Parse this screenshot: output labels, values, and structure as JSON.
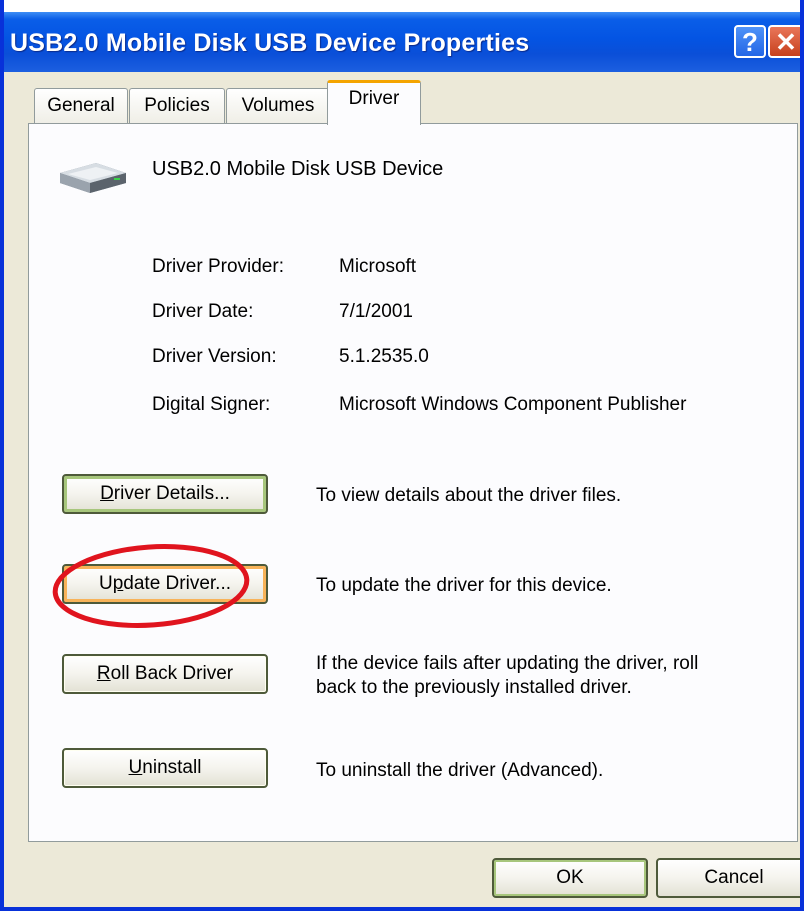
{
  "window": {
    "title": "USB2.0 Mobile Disk USB Device Properties",
    "help_label": "?",
    "close_label": "✕"
  },
  "tabs": [
    {
      "label": "General"
    },
    {
      "label": "Policies"
    },
    {
      "label": "Volumes"
    },
    {
      "label": "Driver",
      "active": true
    }
  ],
  "device": {
    "icon": "disk-drive-icon",
    "name": "USB2.0 Mobile Disk USB Device"
  },
  "driver_info": [
    {
      "label": "Driver Provider:",
      "value": "Microsoft"
    },
    {
      "label": "Driver Date:",
      "value": "7/1/2001"
    },
    {
      "label": "Driver Version:",
      "value": "5.1.2535.0"
    },
    {
      "label": "Digital Signer:",
      "value": "Microsoft Windows Component Publisher"
    }
  ],
  "actions": {
    "details": {
      "label_pre": "",
      "label_key": "D",
      "label_post": "river Details...",
      "desc": "To view details about the driver files."
    },
    "update": {
      "label_pre": "U",
      "label_key": "p",
      "label_post": "date Driver...",
      "desc": "To update the driver for this device."
    },
    "rollback": {
      "label_pre": "",
      "label_key": "R",
      "label_post": "oll Back Driver",
      "desc_line1": "If the device fails after updating the driver, roll",
      "desc_line2": "back to the previously installed driver."
    },
    "uninstall": {
      "label_pre": "",
      "label_key": "U",
      "label_post": "ninstall",
      "desc": "To uninstall the driver (Advanced)."
    }
  },
  "footer": {
    "ok_label": "OK",
    "cancel_label": "Cancel"
  },
  "annotation": {
    "shape": "ellipse",
    "color": "#e0141e"
  }
}
